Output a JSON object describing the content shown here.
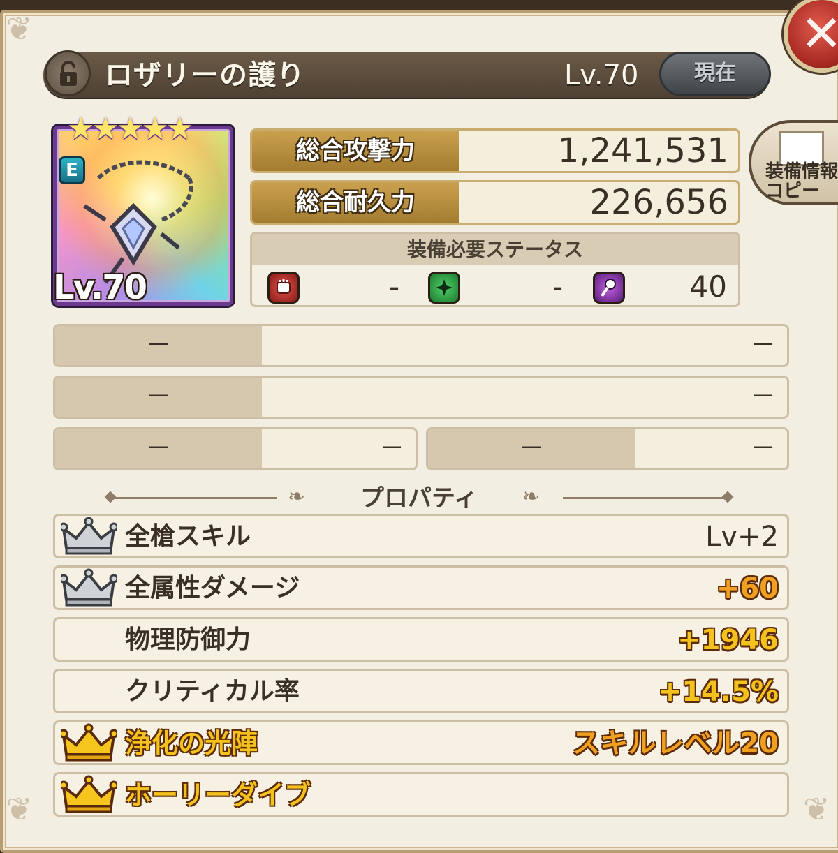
{
  "item": {
    "name": "ロザリーの護り",
    "level_label": "Lv.70",
    "status_button": "現在",
    "icon_level": "Lv.70",
    "rank_badge": "E",
    "stars": "★★★★★"
  },
  "stats": {
    "attack_label": "総合攻撃力",
    "attack_value": "1,241,531",
    "durability_label": "総合耐久力",
    "durability_value": "226,656"
  },
  "requirements": {
    "header": "装備必要ステータス",
    "str_value": "-",
    "dex_value": "-",
    "int_value": "40",
    "icons": [
      "fist-icon",
      "sparkle-icon",
      "staff-icon"
    ]
  },
  "empty_slots": {
    "row1_left": "－",
    "row1_right": "－",
    "row2_left": "－",
    "row2_right": "－",
    "row3a_left": "－",
    "row3a_right": "－",
    "row3b_left": "－",
    "row3b_right": "－"
  },
  "properties_title": "プロパティ",
  "properties": [
    {
      "name": "全槍スキル",
      "value": "Lv+2",
      "crown": "silver"
    },
    {
      "name": "全属性ダメージ",
      "value": "+60",
      "crown": "silver"
    },
    {
      "name": "物理防御力",
      "value": "+1946",
      "crown": "none"
    },
    {
      "name": "クリティカル率",
      "value": "+14.5%",
      "crown": "none"
    },
    {
      "name": "浄化の光陣",
      "value": "スキルレベル20",
      "crown": "gold"
    },
    {
      "name": "ホーリーダイブ",
      "value": "",
      "crown": "gold"
    }
  ],
  "copy_button": {
    "label": "装備情報\nコピー"
  },
  "close_button": {
    "label": "✕"
  },
  "colors": {
    "gold_text": "#f4c21c",
    "header_bar": "#4e4133",
    "stat_label_bg": "#b48b3c"
  }
}
